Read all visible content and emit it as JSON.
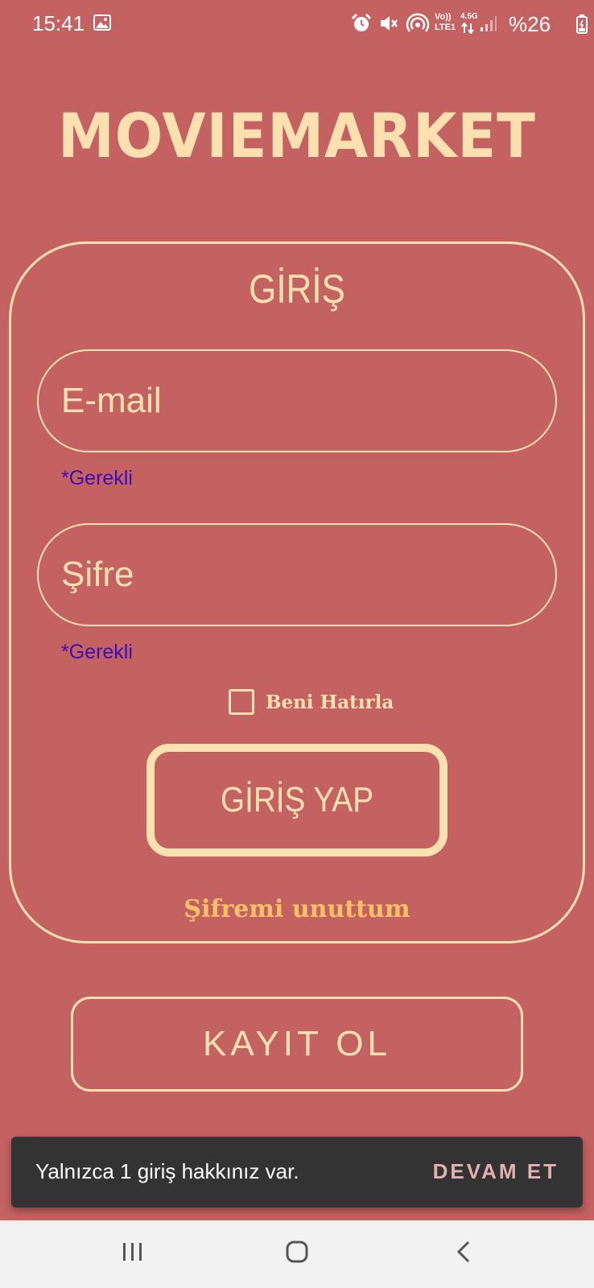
{
  "status_bar": {
    "time": "15:41",
    "battery": "%26",
    "network_label_top": "Vo))",
    "network_label_bottom": "LTE1",
    "network_speed": "4.5G",
    "icons": [
      "gallery-icon",
      "alarm-icon",
      "mute-icon",
      "hotspot-icon",
      "volte-icon",
      "data-arrows-icon",
      "signal-icon",
      "battery-icon"
    ]
  },
  "app": {
    "logo": "MOVIEMARKET"
  },
  "login": {
    "title": "GİRİŞ",
    "email_placeholder": "E-mail",
    "email_value": "",
    "email_required": "*Gerekli",
    "password_placeholder": "Şifre",
    "password_value": "",
    "password_required": "*Gerekli",
    "remember_label": "Beni Hatırla",
    "remember_checked": false,
    "submit_label": "GİRİŞ YAP",
    "forgot_label": "Şifremi unuttum"
  },
  "register": {
    "label": "KAYIT OL"
  },
  "snackbar": {
    "message": "Yalnızca 1 giriş hakkınız var.",
    "action": "DEVAM ET"
  },
  "navigation": {
    "icons": [
      "recent-apps-icon",
      "home-icon",
      "back-icon"
    ]
  },
  "colors": {
    "background": "#c46262",
    "accent": "#fde0b0",
    "forgot_link": "#fcc068",
    "required": "#3a0db8",
    "snackbar": "#333333",
    "nav_bar": "#f2f2f2"
  }
}
